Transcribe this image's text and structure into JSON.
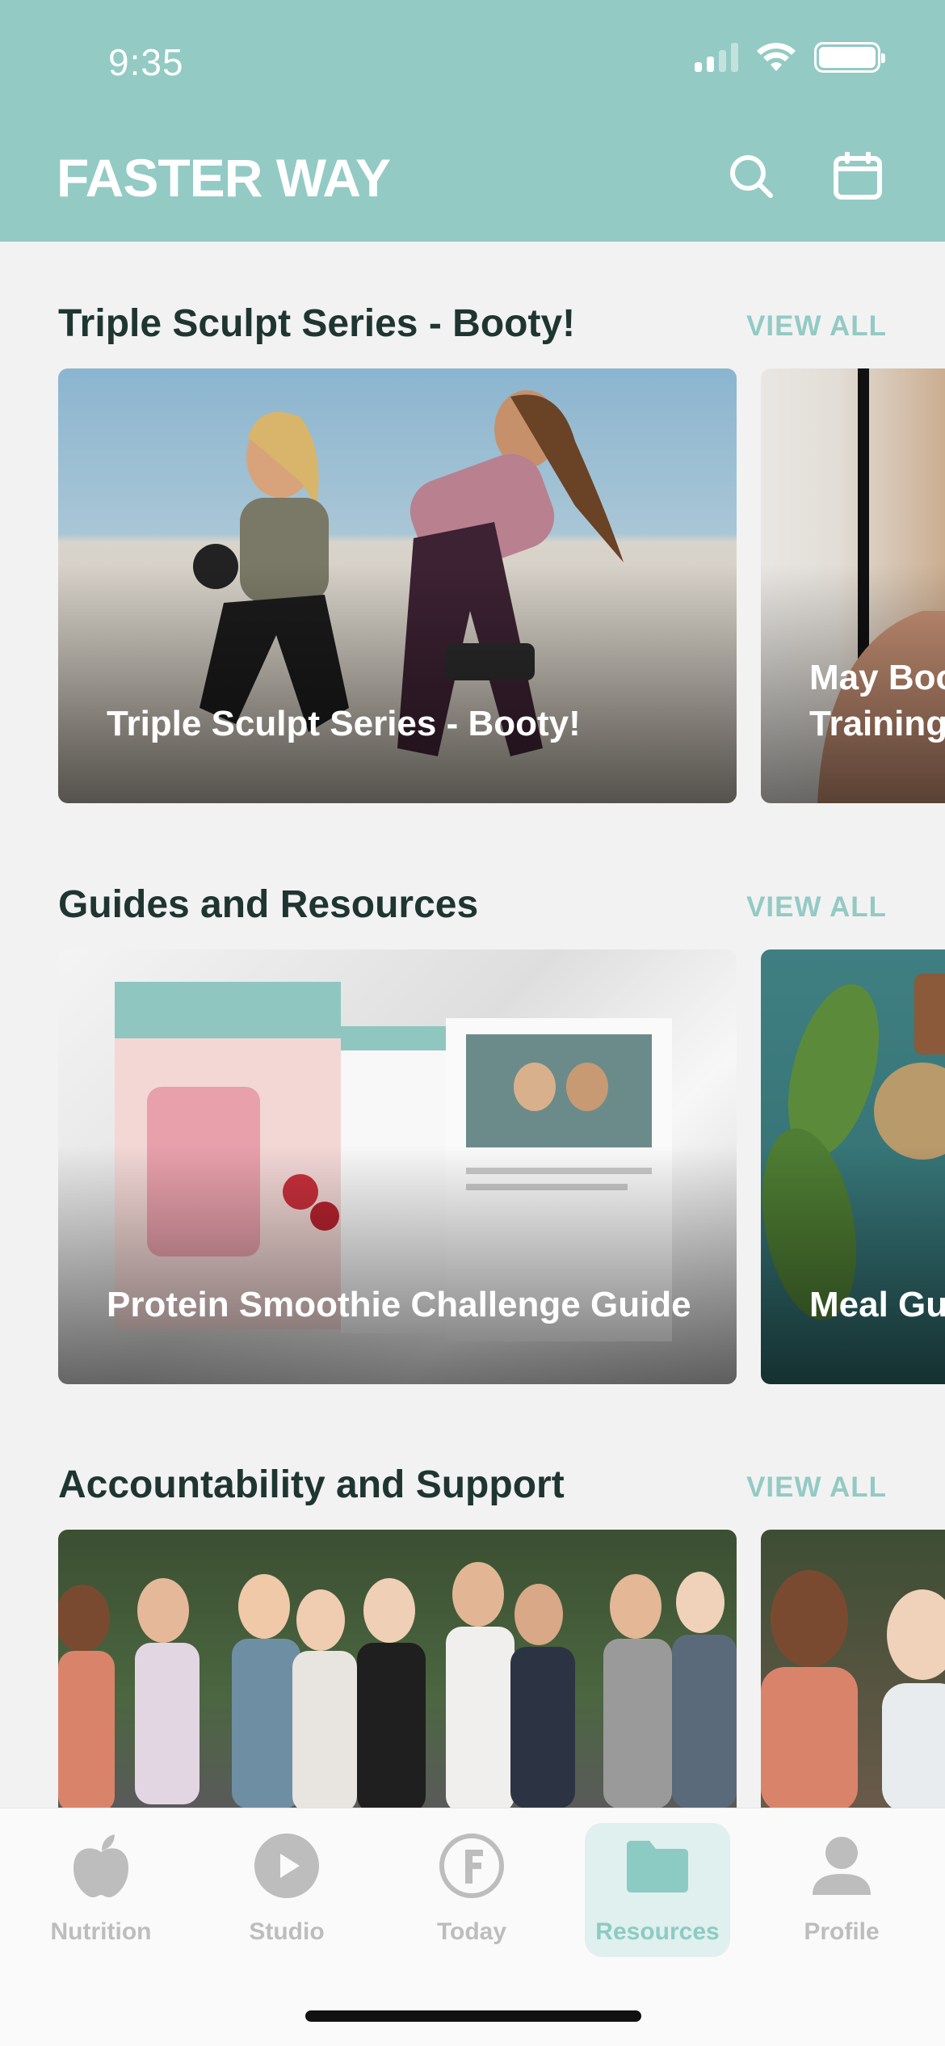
{
  "status_bar": {
    "time": "9:35"
  },
  "header": {
    "brand": "FASTER WAY",
    "search_icon": "search-icon",
    "calendar_icon": "calendar-icon"
  },
  "sections": [
    {
      "title": "Triple Sculpt Series - Booty!",
      "view_all": "VIEW ALL",
      "cards": [
        {
          "title": "Triple Sculpt Series - Booty!"
        },
        {
          "title": "May Boo\nTraining"
        }
      ]
    },
    {
      "title": "Guides and Resources",
      "view_all": "VIEW ALL",
      "cards": [
        {
          "title": "Protein Smoothie Challenge Guide"
        },
        {
          "title": "Meal Gu"
        }
      ]
    },
    {
      "title": "Accountability and Support",
      "view_all": "VIEW ALL",
      "cards": [
        {
          "title": ""
        },
        {
          "title": ""
        }
      ]
    }
  ],
  "tabs": [
    {
      "label": "Nutrition",
      "icon": "apple-icon",
      "active": false
    },
    {
      "label": "Studio",
      "icon": "play-icon",
      "active": false
    },
    {
      "label": "Today",
      "icon": "f-logo-icon",
      "active": false
    },
    {
      "label": "Resources",
      "icon": "folder-icon",
      "active": true
    },
    {
      "label": "Profile",
      "icon": "person-icon",
      "active": false
    }
  ],
  "colors": {
    "accent": "#93cac4",
    "background": "#f2f2f2",
    "title_text": "#1f3530",
    "tab_inactive": "#bdbdbd"
  }
}
